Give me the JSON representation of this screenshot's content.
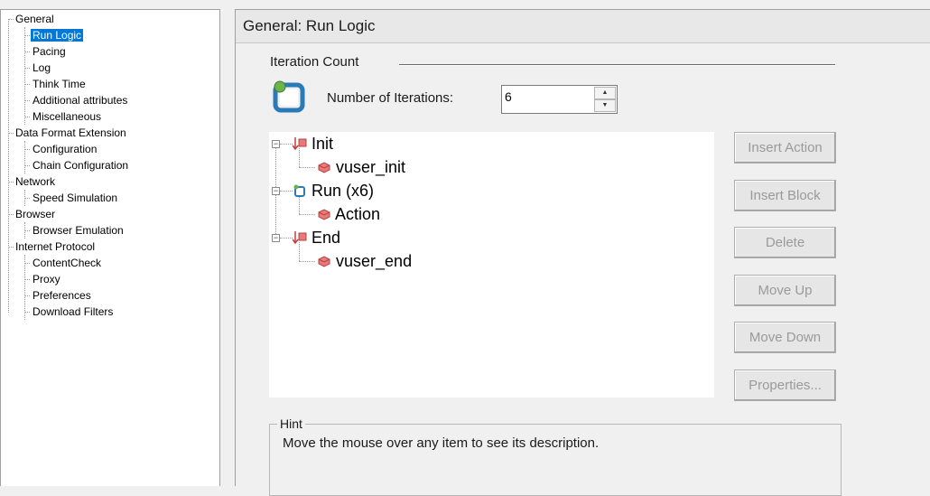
{
  "nav": {
    "items": [
      {
        "label": "General",
        "level": 0
      },
      {
        "label": "Run Logic",
        "level": 1,
        "selected": true
      },
      {
        "label": "Pacing",
        "level": 1
      },
      {
        "label": "Log",
        "level": 1
      },
      {
        "label": "Think Time",
        "level": 1
      },
      {
        "label": "Additional attributes",
        "level": 1
      },
      {
        "label": "Miscellaneous",
        "level": 1
      },
      {
        "label": "Data Format Extension",
        "level": 0
      },
      {
        "label": "Configuration",
        "level": 1
      },
      {
        "label": "Chain Configuration",
        "level": 1
      },
      {
        "label": "Network",
        "level": 0
      },
      {
        "label": "Speed Simulation",
        "level": 1
      },
      {
        "label": "Browser",
        "level": 0
      },
      {
        "label": "Browser Emulation",
        "level": 1
      },
      {
        "label": "Internet Protocol",
        "level": 0
      },
      {
        "label": "ContentCheck",
        "level": 1
      },
      {
        "label": "Proxy",
        "level": 1
      },
      {
        "label": "Preferences",
        "level": 1
      },
      {
        "label": "Download Filters",
        "level": 1
      }
    ]
  },
  "panel": {
    "title": "General: Run Logic",
    "iteration_group": "Iteration Count",
    "iterations_label": "Number of Iterations:",
    "iterations_value": "6"
  },
  "tree": {
    "nodes": [
      {
        "label": "Init",
        "icon": "init-arrow-icon",
        "children": [
          {
            "label": "vuser_init",
            "icon": "action-block-icon"
          }
        ]
      },
      {
        "label": "Run (x6)",
        "icon": "run-loop-icon",
        "children": [
          {
            "label": "Action",
            "icon": "action-block-icon"
          }
        ]
      },
      {
        "label": "End",
        "icon": "end-arrow-icon",
        "children": [
          {
            "label": "vuser_end",
            "icon": "action-block-icon"
          }
        ]
      }
    ]
  },
  "buttons": {
    "insert_action": "Insert Action",
    "insert_block": "Insert Block",
    "delete": "Delete",
    "move_up": "Move Up",
    "move_down": "Move Down",
    "properties": "Properties..."
  },
  "hint": {
    "legend": "Hint",
    "text": "Move the mouse over any item to see its description."
  },
  "colors": {
    "selection": "#0078d7",
    "disabled_text": "#9a9a9a",
    "action_icon": "#e05555",
    "loop_icon": "#2a7ab8"
  }
}
